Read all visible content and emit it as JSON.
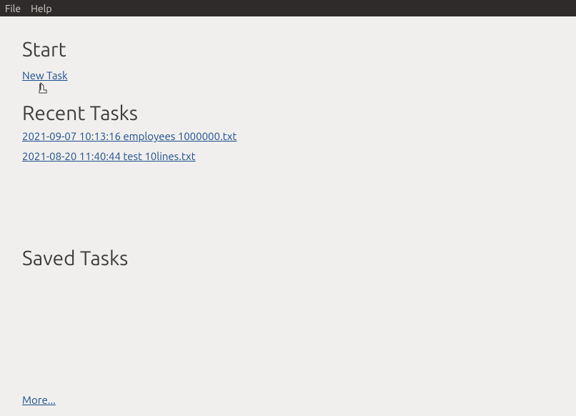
{
  "menubar": {
    "file": "File",
    "help": "Help"
  },
  "sections": {
    "start": "Start",
    "recent": "Recent Tasks",
    "saved": "Saved Tasks"
  },
  "start_link": "New Task",
  "recent_tasks": [
    "2021-09-07 10:13:16  employees  1000000.txt",
    "2021-08-20 11:40:44  test  10lines.txt"
  ],
  "more_link": "More..."
}
